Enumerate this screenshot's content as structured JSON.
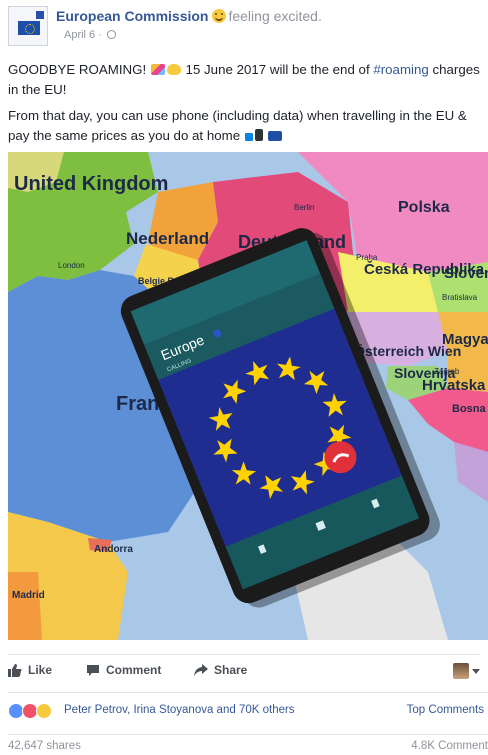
{
  "post": {
    "author": "European Commission",
    "feeling": "feeling excited.",
    "date": "April 6 ·",
    "line1_before": "GOODBYE ROAMING! ",
    "line1_after": " 15 June 2017 will be the end of ",
    "hashtag": "#roaming",
    "line1_end": " charges in the EU!",
    "line2": "From that day, you can use phone (including data) when travelling in the EU & pay the same prices as you do at home "
  },
  "photo": {
    "countries": [
      "United Kingdom",
      "Nederland",
      "Belgie Brussel",
      "Deutschland",
      "Polska",
      "Česká Republika",
      "Sloven",
      "Österreich Wien",
      "Magyaro",
      "Slovenija",
      "Hrvatska",
      "Bosna Herceg",
      "France",
      "Andorra",
      "Madrid",
      "Berlin",
      "Praha",
      "Bratislava",
      "London",
      "Zagreb"
    ],
    "phone_title": "Europe",
    "phone_subtitle": "CALLING"
  },
  "actions": {
    "like": "Like",
    "comment": "Comment",
    "share": "Share"
  },
  "reactions": {
    "reactors": "Peter Petrov, Irina Stoyanova and 70K others",
    "top_comments": "Top Comments"
  },
  "stats": {
    "shares": "42,647 shares",
    "comments": "4.8K Comment"
  },
  "colors": {
    "link": "#365899",
    "eu_blue": "#1e2d8f",
    "eu_star": "#ffd200",
    "decline_red": "#e0313a"
  }
}
